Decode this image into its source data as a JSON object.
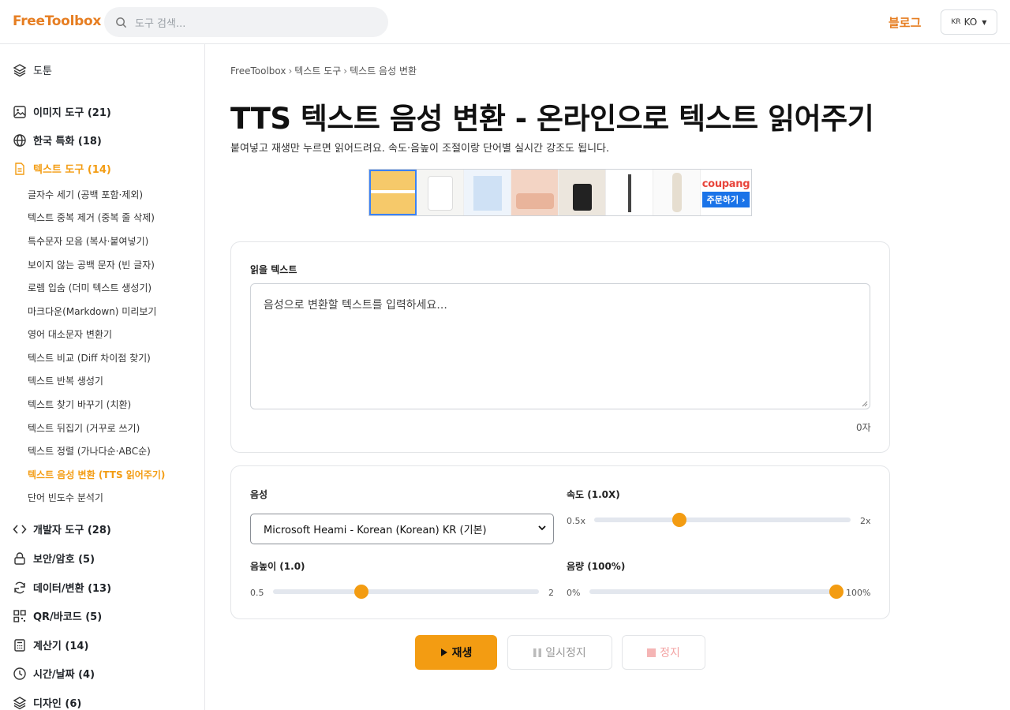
{
  "header": {
    "logo": "FreeToolbox",
    "search_placeholder": "도구 검색...",
    "blog_link": "블로그",
    "lang_flag": "KR",
    "lang_label": "KO"
  },
  "sidebar": {
    "top_item": "도툰",
    "categories": [
      {
        "label": "이미지 도구 (21)",
        "icon": "image-icon"
      },
      {
        "label": "한국 특화 (18)",
        "icon": "globe-icon"
      },
      {
        "label": "텍스트 도구 (14)",
        "icon": "document-icon",
        "active": true
      },
      {
        "label": "개발자 도구 (28)",
        "icon": "code-icon"
      },
      {
        "label": "보안/암호 (5)",
        "icon": "lock-icon"
      },
      {
        "label": "데이터/변환 (13)",
        "icon": "refresh-icon"
      },
      {
        "label": "QR/바코드 (5)",
        "icon": "qr-icon"
      },
      {
        "label": "계산기 (14)",
        "icon": "calculator-icon"
      },
      {
        "label": "시간/날짜 (4)",
        "icon": "clock-icon"
      },
      {
        "label": "디자인 (6)",
        "icon": "layers-icon"
      }
    ],
    "text_tools": [
      "글자수 세기 (공백 포함·제외)",
      "텍스트 중복 제거 (중복 줄 삭제)",
      "특수문자 모음 (복사·붙여넣기)",
      "보이지 않는 공백 문자 (빈 글자)",
      "로렘 입숨 (더미 텍스트 생성기)",
      "마크다운(Markdown) 미리보기",
      "영어 대소문자 변환기",
      "텍스트 비교 (Diff 차이점 찾기)",
      "텍스트 반복 생성기",
      "텍스트 찾기 바꾸기 (치환)",
      "텍스트 뒤집기 (거꾸로 쓰기)",
      "텍스트 정렬 (가나다순·ABC순)",
      "텍스트 음성 변환 (TTS 읽어주기)",
      "단어 빈도수 분석기"
    ]
  },
  "breadcrumb": [
    "FreeToolbox",
    "텍스트 도구",
    "텍스트 음성 변환"
  ],
  "breadcrumb_sep": "›",
  "page": {
    "title": "TTS 텍스트 음성 변환 - 온라인으로 텍스트 읽어주기",
    "subtitle": "붙여넣고 재생만 누르면 읽어드려요. 속도·음높이 조절이랑 단어별 실시간 강조도 됩니다."
  },
  "ad": {
    "brand": "coupang",
    "cta": "주문하기 ›"
  },
  "input": {
    "label": "읽을 텍스트",
    "placeholder": "음성으로 변환할 텍스트를 입력하세요...",
    "count": "0자"
  },
  "settings": {
    "voice_label": "음성",
    "voice_value": "Microsoft Heami - Korean (Korean) KR (기본)",
    "speed": {
      "label": "속도 (1.0X)",
      "min": "0.5x",
      "max": "2x",
      "value": 1.0,
      "range": [
        0.5,
        2
      ]
    },
    "pitch": {
      "label": "음높이 (1.0)",
      "min": "0.5",
      "max": "2",
      "value": 1.0,
      "range": [
        0.5,
        2
      ]
    },
    "volume": {
      "label": "음량 (100%)",
      "min": "0%",
      "max": "100%",
      "value": 100,
      "range": [
        0,
        100
      ]
    }
  },
  "buttons": {
    "play": "재생",
    "pause": "일시정지",
    "stop": "정지"
  },
  "colors": {
    "accent": "#f39c12",
    "brand": "#e67e22"
  }
}
